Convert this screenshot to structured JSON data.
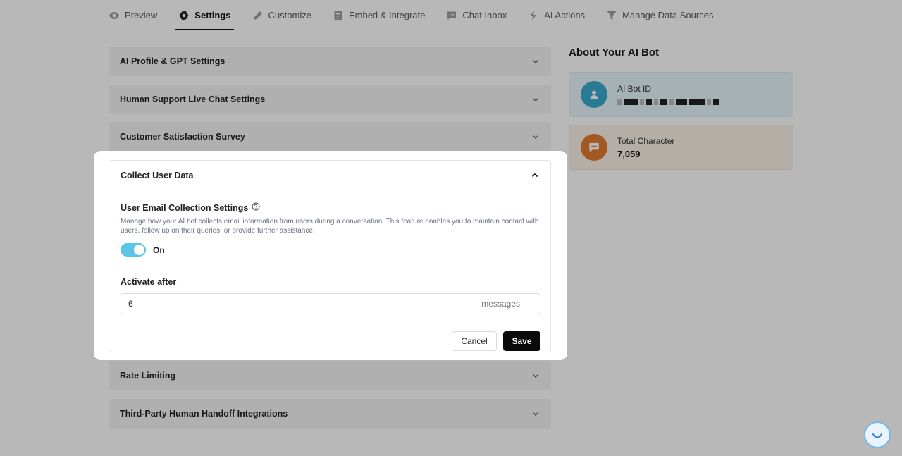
{
  "nav": {
    "tabs": [
      {
        "label": "Preview",
        "icon": "eye-icon"
      },
      {
        "label": "Settings",
        "icon": "gear-icon",
        "active": true
      },
      {
        "label": "Customize",
        "icon": "pencil-icon"
      },
      {
        "label": "Embed & Integrate",
        "icon": "code-document-icon"
      },
      {
        "label": "Chat Inbox",
        "icon": "chat-icon"
      },
      {
        "label": "AI Actions",
        "icon": "bolt-icon"
      },
      {
        "label": "Manage Data Sources",
        "icon": "funnel-icon"
      }
    ]
  },
  "accordions": {
    "ai_profile": "AI Profile & GPT Settings",
    "human_support": "Human Support Live Chat Settings",
    "survey": "Customer Satisfaction Survey",
    "rate_limiting": "Rate Limiting",
    "third_party": "Third-Party Human Handoff Integrations"
  },
  "modal": {
    "title": "Collect User Data",
    "section_title": "User Email Collection Settings",
    "description": "Manage how your AI bot collects email information from users during a conversation. This feature enables you to maintain contact with users, follow up on their queries, or provide further assistance.",
    "toggle_state": "On",
    "activate_label": "Activate after",
    "activate_value": "6",
    "activate_suffix": "messages",
    "cancel_label": "Cancel",
    "save_label": "Save"
  },
  "about": {
    "title": "About Your AI Bot",
    "bot_id_label": "AI Bot ID",
    "total_char_label": "Total Character",
    "total_char_value": "7,059"
  },
  "colors": {
    "accent_toggle": "#5bc5e6",
    "bot_id_avatar": "#3aa9cf",
    "char_avatar": "#e07b2e",
    "save_button": "#0a0a0a"
  }
}
